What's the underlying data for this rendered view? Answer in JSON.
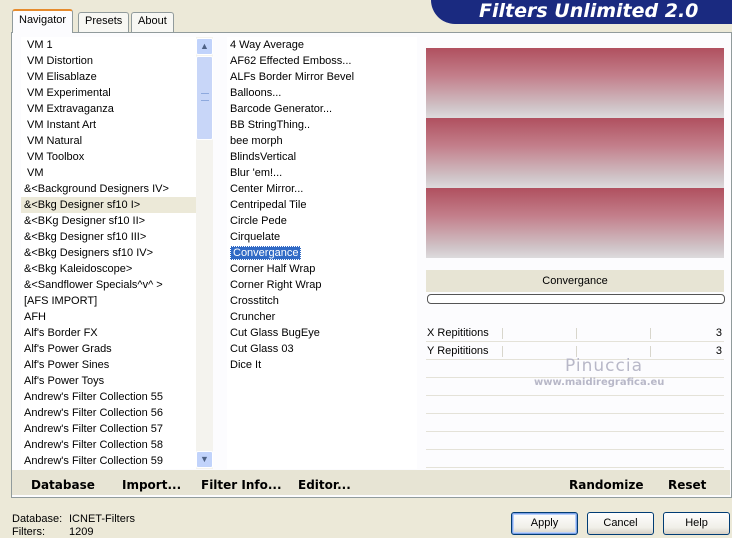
{
  "banner_title": "Filters Unlimited 2.0",
  "tabs": [
    {
      "label": "Navigator",
      "active": true
    },
    {
      "label": "Presets",
      "active": false
    },
    {
      "label": "About",
      "active": false
    }
  ],
  "categories": [
    "VM 1",
    "VM Distortion",
    "VM Elisablaze",
    "VM Experimental",
    "VM Extravaganza",
    "VM Instant Art",
    "VM Natural",
    "VM Toolbox",
    "VM",
    "&<Background Designers IV>",
    "&<Bkg Designer sf10 I>",
    "&<BKg Designer sf10 II>",
    "&<Bkg Designer sf10 III>",
    "&<Bkg Designers sf10 IV>",
    "&<Bkg Kaleidoscope>",
    "&<Sandflower Specials^v^ >",
    "[AFS IMPORT]",
    "AFH",
    "Alf's Border FX",
    "Alf's Power Grads",
    "Alf's Power Sines",
    "Alf's Power Toys",
    "Andrew's Filter Collection 55",
    "Andrew's Filter Collection 56",
    "Andrew's Filter Collection 57",
    "Andrew's Filter Collection 58",
    "Andrew's Filter Collection 59"
  ],
  "selected_category": "&<Bkg Designer sf10 I>",
  "filters": [
    "4 Way Average",
    "AF62 Effected Emboss...",
    "ALFs Border Mirror Bevel",
    "Balloons...",
    "Barcode Generator...",
    "BB StringThing..",
    "bee morph",
    "BlindsVertical",
    "Blur 'em!...",
    "Center Mirror...",
    "Centripedal Tile",
    "Circle Pede",
    "Cirquelate",
    "Convergance",
    "Corner Half Wrap",
    "Corner Right Wrap",
    "Crosstitch",
    "Cruncher",
    "Cut Glass  BugEye",
    "Cut Glass 03",
    "Dice It"
  ],
  "selected_filter": "Convergance",
  "preview": {
    "filter_name": "Convergance",
    "colors": {
      "stripe_top": "#b0505f",
      "stripe_bottom": "#dddbdd"
    }
  },
  "params": [
    {
      "label": "X Repititions",
      "value": "3"
    },
    {
      "label": "Y Repititions",
      "value": "3"
    }
  ],
  "watermark": {
    "name": "Pinuccia",
    "site": "www.maidiregrafica.eu"
  },
  "action_bar": {
    "database": "Database",
    "import": "Import...",
    "filter_info": "Filter Info...",
    "editor": "Editor...",
    "randomize": "Randomize",
    "reset": "Reset"
  },
  "status": {
    "database_label": "Database:",
    "database_value": "ICNET-Filters",
    "filters_label": "Filters:",
    "filters_value": "1209"
  },
  "buttons": {
    "apply": "Apply",
    "cancel": "Cancel",
    "help": "Help"
  },
  "scrollbar": {
    "up_icon": "arrow-up",
    "down_icon": "arrow-down"
  }
}
